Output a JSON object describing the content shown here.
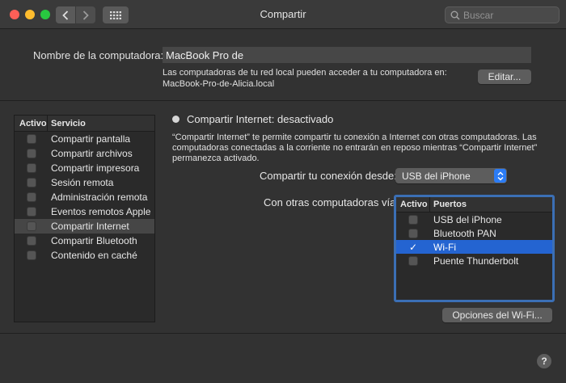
{
  "window": {
    "title": "Compartir"
  },
  "search": {
    "placeholder": "Buscar"
  },
  "computer_name": {
    "label": "Nombre de la computadora:",
    "value": "MacBook Pro de",
    "description_line1": "Las computadoras de tu red local pueden acceder a tu computadora en:",
    "description_line2": "MacBook-Pro-de-Alicia.local",
    "edit_label": "Editar..."
  },
  "services": {
    "col_active": "Activo",
    "col_service": "Servicio",
    "items": [
      {
        "label": "Compartir pantalla",
        "checked": false,
        "selected": false
      },
      {
        "label": "Compartir archivos",
        "checked": false,
        "selected": false
      },
      {
        "label": "Compartir impresora",
        "checked": false,
        "selected": false
      },
      {
        "label": "Sesión remota",
        "checked": false,
        "selected": false
      },
      {
        "label": "Administración remota",
        "checked": false,
        "selected": false
      },
      {
        "label": "Eventos remotos Apple",
        "checked": false,
        "selected": false
      },
      {
        "label": "Compartir Internet",
        "checked": false,
        "selected": true
      },
      {
        "label": "Compartir Bluetooth",
        "checked": false,
        "selected": false
      },
      {
        "label": "Contenido en caché",
        "checked": false,
        "selected": false
      }
    ]
  },
  "internet_sharing": {
    "status": "Compartir Internet: desactivado",
    "info": "“Compartir Internet” te permite compartir tu conexión a Internet con otras computadoras. Las computadoras conectadas a la corriente no entrarán en reposo mientras “Compartir Internet” permanezca activado.",
    "share_from_label": "Compartir tu conexión desde:",
    "share_from_value": "USB del iPhone",
    "via_label": "Con otras computadoras vía:",
    "ports_col_active": "Activo",
    "ports_col_ports": "Puertos",
    "ports": [
      {
        "label": "USB del iPhone",
        "checked": false,
        "selected": false
      },
      {
        "label": "Bluetooth PAN",
        "checked": false,
        "selected": false
      },
      {
        "label": "Wi-Fi",
        "checked": true,
        "selected": true
      },
      {
        "label": "Puente Thunderbolt",
        "checked": false,
        "selected": false
      }
    ],
    "wifi_options_label": "Opciones del Wi-Fi..."
  },
  "help": {
    "label": "?"
  },
  "colors": {
    "accent": "#2464d1",
    "focus_ring": "#3b6fb5",
    "close": "#fe5f57",
    "minimize": "#febc2e",
    "maximize": "#28c840"
  }
}
